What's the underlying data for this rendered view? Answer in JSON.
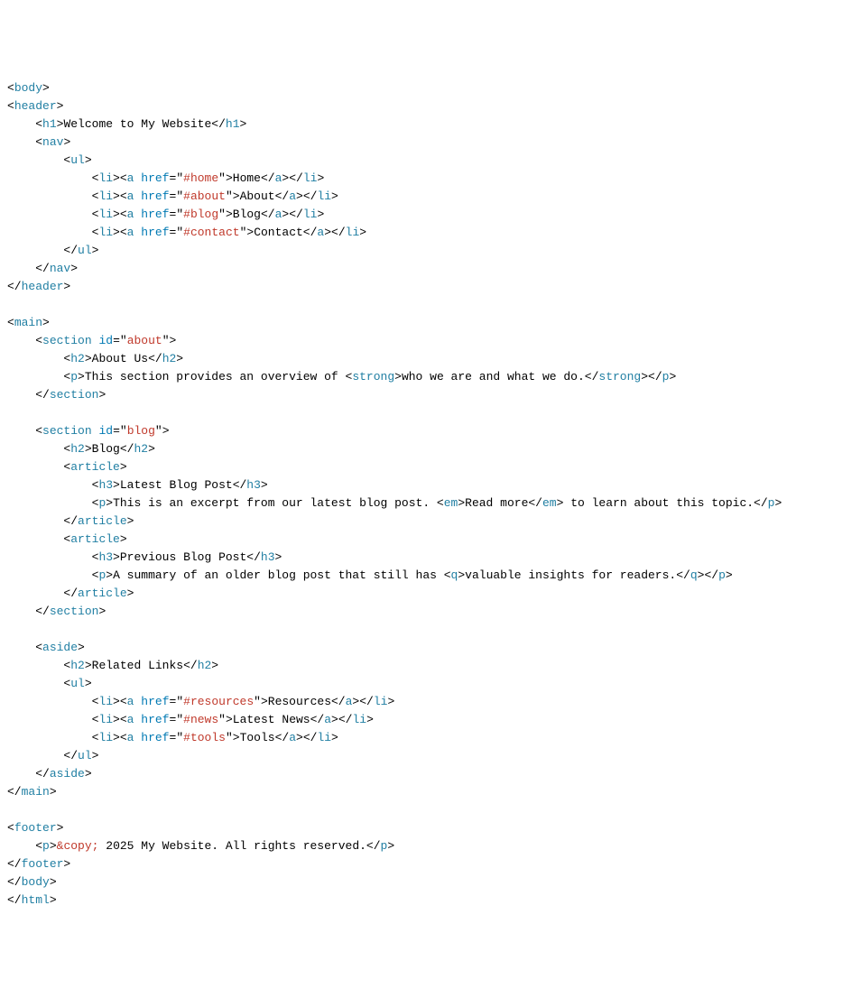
{
  "lines": [
    [
      [
        "pun",
        "<"
      ],
      [
        "tag",
        "body"
      ],
      [
        "pun",
        ">"
      ]
    ],
    [
      [
        "pun",
        "<"
      ],
      [
        "tag",
        "header"
      ],
      [
        "pun",
        ">"
      ]
    ],
    [
      [
        "txt",
        "    "
      ],
      [
        "pun",
        "<"
      ],
      [
        "tag",
        "h1"
      ],
      [
        "pun",
        ">"
      ],
      [
        "txt",
        "Welcome to My Website"
      ],
      [
        "pun",
        "</"
      ],
      [
        "tag",
        "h1"
      ],
      [
        "pun",
        ">"
      ]
    ],
    [
      [
        "txt",
        "    "
      ],
      [
        "pun",
        "<"
      ],
      [
        "tag",
        "nav"
      ],
      [
        "pun",
        ">"
      ]
    ],
    [
      [
        "txt",
        "        "
      ],
      [
        "pun",
        "<"
      ],
      [
        "tag",
        "ul"
      ],
      [
        "pun",
        ">"
      ]
    ],
    [
      [
        "txt",
        "            "
      ],
      [
        "pun",
        "<"
      ],
      [
        "tag",
        "li"
      ],
      [
        "pun",
        ">"
      ],
      [
        "pun",
        "<"
      ],
      [
        "tag",
        "a"
      ],
      [
        "txt",
        " "
      ],
      [
        "attr",
        "href"
      ],
      [
        "pun",
        "="
      ],
      [
        "pun",
        "\""
      ],
      [
        "val",
        "#home"
      ],
      [
        "pun",
        "\""
      ],
      [
        "pun",
        ">"
      ],
      [
        "txt",
        "Home"
      ],
      [
        "pun",
        "</"
      ],
      [
        "tag",
        "a"
      ],
      [
        "pun",
        ">"
      ],
      [
        "pun",
        "</"
      ],
      [
        "tag",
        "li"
      ],
      [
        "pun",
        ">"
      ]
    ],
    [
      [
        "txt",
        "            "
      ],
      [
        "pun",
        "<"
      ],
      [
        "tag",
        "li"
      ],
      [
        "pun",
        ">"
      ],
      [
        "pun",
        "<"
      ],
      [
        "tag",
        "a"
      ],
      [
        "txt",
        " "
      ],
      [
        "attr",
        "href"
      ],
      [
        "pun",
        "="
      ],
      [
        "pun",
        "\""
      ],
      [
        "val",
        "#about"
      ],
      [
        "pun",
        "\""
      ],
      [
        "pun",
        ">"
      ],
      [
        "txt",
        "About"
      ],
      [
        "pun",
        "</"
      ],
      [
        "tag",
        "a"
      ],
      [
        "pun",
        ">"
      ],
      [
        "pun",
        "</"
      ],
      [
        "tag",
        "li"
      ],
      [
        "pun",
        ">"
      ]
    ],
    [
      [
        "txt",
        "            "
      ],
      [
        "pun",
        "<"
      ],
      [
        "tag",
        "li"
      ],
      [
        "pun",
        ">"
      ],
      [
        "pun",
        "<"
      ],
      [
        "tag",
        "a"
      ],
      [
        "txt",
        " "
      ],
      [
        "attr",
        "href"
      ],
      [
        "pun",
        "="
      ],
      [
        "pun",
        "\""
      ],
      [
        "val",
        "#blog"
      ],
      [
        "pun",
        "\""
      ],
      [
        "pun",
        ">"
      ],
      [
        "txt",
        "Blog"
      ],
      [
        "pun",
        "</"
      ],
      [
        "tag",
        "a"
      ],
      [
        "pun",
        ">"
      ],
      [
        "pun",
        "</"
      ],
      [
        "tag",
        "li"
      ],
      [
        "pun",
        ">"
      ]
    ],
    [
      [
        "txt",
        "            "
      ],
      [
        "pun",
        "<"
      ],
      [
        "tag",
        "li"
      ],
      [
        "pun",
        ">"
      ],
      [
        "pun",
        "<"
      ],
      [
        "tag",
        "a"
      ],
      [
        "txt",
        " "
      ],
      [
        "attr",
        "href"
      ],
      [
        "pun",
        "="
      ],
      [
        "pun",
        "\""
      ],
      [
        "val",
        "#contact"
      ],
      [
        "pun",
        "\""
      ],
      [
        "pun",
        ">"
      ],
      [
        "txt",
        "Contact"
      ],
      [
        "pun",
        "</"
      ],
      [
        "tag",
        "a"
      ],
      [
        "pun",
        ">"
      ],
      [
        "pun",
        "</"
      ],
      [
        "tag",
        "li"
      ],
      [
        "pun",
        ">"
      ]
    ],
    [
      [
        "txt",
        "        "
      ],
      [
        "pun",
        "</"
      ],
      [
        "tag",
        "ul"
      ],
      [
        "pun",
        ">"
      ]
    ],
    [
      [
        "txt",
        "    "
      ],
      [
        "pun",
        "</"
      ],
      [
        "tag",
        "nav"
      ],
      [
        "pun",
        ">"
      ]
    ],
    [
      [
        "pun",
        "</"
      ],
      [
        "tag",
        "header"
      ],
      [
        "pun",
        ">"
      ]
    ],
    [],
    [
      [
        "pun",
        "<"
      ],
      [
        "tag",
        "main"
      ],
      [
        "pun",
        ">"
      ]
    ],
    [
      [
        "txt",
        "    "
      ],
      [
        "pun",
        "<"
      ],
      [
        "tag",
        "section"
      ],
      [
        "txt",
        " "
      ],
      [
        "attr",
        "id"
      ],
      [
        "pun",
        "="
      ],
      [
        "pun",
        "\""
      ],
      [
        "val",
        "about"
      ],
      [
        "pun",
        "\""
      ],
      [
        "pun",
        ">"
      ]
    ],
    [
      [
        "txt",
        "        "
      ],
      [
        "pun",
        "<"
      ],
      [
        "tag",
        "h2"
      ],
      [
        "pun",
        ">"
      ],
      [
        "txt",
        "About Us"
      ],
      [
        "pun",
        "</"
      ],
      [
        "tag",
        "h2"
      ],
      [
        "pun",
        ">"
      ]
    ],
    [
      [
        "txt",
        "        "
      ],
      [
        "pun",
        "<"
      ],
      [
        "tag",
        "p"
      ],
      [
        "pun",
        ">"
      ],
      [
        "txt",
        "This section provides an overview of "
      ],
      [
        "pun",
        "<"
      ],
      [
        "tag",
        "strong"
      ],
      [
        "pun",
        ">"
      ],
      [
        "txt",
        "who we are and what we do."
      ],
      [
        "pun",
        "</"
      ],
      [
        "tag",
        "strong"
      ],
      [
        "pun",
        ">"
      ],
      [
        "pun",
        "</"
      ],
      [
        "tag",
        "p"
      ],
      [
        "pun",
        ">"
      ]
    ],
    [
      [
        "txt",
        "    "
      ],
      [
        "pun",
        "</"
      ],
      [
        "tag",
        "section"
      ],
      [
        "pun",
        ">"
      ]
    ],
    [],
    [
      [
        "txt",
        "    "
      ],
      [
        "pun",
        "<"
      ],
      [
        "tag",
        "section"
      ],
      [
        "txt",
        " "
      ],
      [
        "attr",
        "id"
      ],
      [
        "pun",
        "="
      ],
      [
        "pun",
        "\""
      ],
      [
        "val",
        "blog"
      ],
      [
        "pun",
        "\""
      ],
      [
        "pun",
        ">"
      ]
    ],
    [
      [
        "txt",
        "        "
      ],
      [
        "pun",
        "<"
      ],
      [
        "tag",
        "h2"
      ],
      [
        "pun",
        ">"
      ],
      [
        "txt",
        "Blog"
      ],
      [
        "pun",
        "</"
      ],
      [
        "tag",
        "h2"
      ],
      [
        "pun",
        ">"
      ]
    ],
    [
      [
        "txt",
        "        "
      ],
      [
        "pun",
        "<"
      ],
      [
        "tag",
        "article"
      ],
      [
        "pun",
        ">"
      ]
    ],
    [
      [
        "txt",
        "            "
      ],
      [
        "pun",
        "<"
      ],
      [
        "tag",
        "h3"
      ],
      [
        "pun",
        ">"
      ],
      [
        "txt",
        "Latest Blog Post"
      ],
      [
        "pun",
        "</"
      ],
      [
        "tag",
        "h3"
      ],
      [
        "pun",
        ">"
      ]
    ],
    [
      [
        "txt",
        "            "
      ],
      [
        "pun",
        "<"
      ],
      [
        "tag",
        "p"
      ],
      [
        "pun",
        ">"
      ],
      [
        "txt",
        "This is an excerpt from our latest blog post. "
      ],
      [
        "pun",
        "<"
      ],
      [
        "tag",
        "em"
      ],
      [
        "pun",
        ">"
      ],
      [
        "txt",
        "Read more"
      ],
      [
        "pun",
        "</"
      ],
      [
        "tag",
        "em"
      ],
      [
        "pun",
        ">"
      ],
      [
        "txt",
        " to learn about this topic."
      ],
      [
        "pun",
        "</"
      ],
      [
        "tag",
        "p"
      ],
      [
        "pun",
        ">"
      ]
    ],
    [
      [
        "txt",
        "        "
      ],
      [
        "pun",
        "</"
      ],
      [
        "tag",
        "article"
      ],
      [
        "pun",
        ">"
      ]
    ],
    [
      [
        "txt",
        "        "
      ],
      [
        "pun",
        "<"
      ],
      [
        "tag",
        "article"
      ],
      [
        "pun",
        ">"
      ]
    ],
    [
      [
        "txt",
        "            "
      ],
      [
        "pun",
        "<"
      ],
      [
        "tag",
        "h3"
      ],
      [
        "pun",
        ">"
      ],
      [
        "txt",
        "Previous Blog Post"
      ],
      [
        "pun",
        "</"
      ],
      [
        "tag",
        "h3"
      ],
      [
        "pun",
        ">"
      ]
    ],
    [
      [
        "txt",
        "            "
      ],
      [
        "pun",
        "<"
      ],
      [
        "tag",
        "p"
      ],
      [
        "pun",
        ">"
      ],
      [
        "txt",
        "A summary of an older blog post that still has "
      ],
      [
        "pun",
        "<"
      ],
      [
        "tag",
        "q"
      ],
      [
        "pun",
        ">"
      ],
      [
        "txt",
        "valuable insights for readers."
      ],
      [
        "pun",
        "</"
      ],
      [
        "tag",
        "q"
      ],
      [
        "pun",
        ">"
      ],
      [
        "pun",
        "</"
      ],
      [
        "tag",
        "p"
      ],
      [
        "pun",
        ">"
      ]
    ],
    [
      [
        "txt",
        "        "
      ],
      [
        "pun",
        "</"
      ],
      [
        "tag",
        "article"
      ],
      [
        "pun",
        ">"
      ]
    ],
    [
      [
        "txt",
        "    "
      ],
      [
        "pun",
        "</"
      ],
      [
        "tag",
        "section"
      ],
      [
        "pun",
        ">"
      ]
    ],
    [],
    [
      [
        "txt",
        "    "
      ],
      [
        "pun",
        "<"
      ],
      [
        "tag",
        "aside"
      ],
      [
        "pun",
        ">"
      ]
    ],
    [
      [
        "txt",
        "        "
      ],
      [
        "pun",
        "<"
      ],
      [
        "tag",
        "h2"
      ],
      [
        "pun",
        ">"
      ],
      [
        "txt",
        "Related Links"
      ],
      [
        "pun",
        "</"
      ],
      [
        "tag",
        "h2"
      ],
      [
        "pun",
        ">"
      ]
    ],
    [
      [
        "txt",
        "        "
      ],
      [
        "pun",
        "<"
      ],
      [
        "tag",
        "ul"
      ],
      [
        "pun",
        ">"
      ]
    ],
    [
      [
        "txt",
        "            "
      ],
      [
        "pun",
        "<"
      ],
      [
        "tag",
        "li"
      ],
      [
        "pun",
        ">"
      ],
      [
        "pun",
        "<"
      ],
      [
        "tag",
        "a"
      ],
      [
        "txt",
        " "
      ],
      [
        "attr",
        "href"
      ],
      [
        "pun",
        "="
      ],
      [
        "pun",
        "\""
      ],
      [
        "val",
        "#resources"
      ],
      [
        "pun",
        "\""
      ],
      [
        "pun",
        ">"
      ],
      [
        "txt",
        "Resources"
      ],
      [
        "pun",
        "</"
      ],
      [
        "tag",
        "a"
      ],
      [
        "pun",
        ">"
      ],
      [
        "pun",
        "</"
      ],
      [
        "tag",
        "li"
      ],
      [
        "pun",
        ">"
      ]
    ],
    [
      [
        "txt",
        "            "
      ],
      [
        "pun",
        "<"
      ],
      [
        "tag",
        "li"
      ],
      [
        "pun",
        ">"
      ],
      [
        "pun",
        "<"
      ],
      [
        "tag",
        "a"
      ],
      [
        "txt",
        " "
      ],
      [
        "attr",
        "href"
      ],
      [
        "pun",
        "="
      ],
      [
        "pun",
        "\""
      ],
      [
        "val",
        "#news"
      ],
      [
        "pun",
        "\""
      ],
      [
        "pun",
        ">"
      ],
      [
        "txt",
        "Latest News"
      ],
      [
        "pun",
        "</"
      ],
      [
        "tag",
        "a"
      ],
      [
        "pun",
        ">"
      ],
      [
        "pun",
        "</"
      ],
      [
        "tag",
        "li"
      ],
      [
        "pun",
        ">"
      ]
    ],
    [
      [
        "txt",
        "            "
      ],
      [
        "pun",
        "<"
      ],
      [
        "tag",
        "li"
      ],
      [
        "pun",
        ">"
      ],
      [
        "pun",
        "<"
      ],
      [
        "tag",
        "a"
      ],
      [
        "txt",
        " "
      ],
      [
        "attr",
        "href"
      ],
      [
        "pun",
        "="
      ],
      [
        "pun",
        "\""
      ],
      [
        "val",
        "#tools"
      ],
      [
        "pun",
        "\""
      ],
      [
        "pun",
        ">"
      ],
      [
        "txt",
        "Tools"
      ],
      [
        "pun",
        "</"
      ],
      [
        "tag",
        "a"
      ],
      [
        "pun",
        ">"
      ],
      [
        "pun",
        "</"
      ],
      [
        "tag",
        "li"
      ],
      [
        "pun",
        ">"
      ]
    ],
    [
      [
        "txt",
        "        "
      ],
      [
        "pun",
        "</"
      ],
      [
        "tag",
        "ul"
      ],
      [
        "pun",
        ">"
      ]
    ],
    [
      [
        "txt",
        "    "
      ],
      [
        "pun",
        "</"
      ],
      [
        "tag",
        "aside"
      ],
      [
        "pun",
        ">"
      ]
    ],
    [
      [
        "pun",
        "</"
      ],
      [
        "tag",
        "main"
      ],
      [
        "pun",
        ">"
      ]
    ],
    [],
    [
      [
        "pun",
        "<"
      ],
      [
        "tag",
        "footer"
      ],
      [
        "pun",
        ">"
      ]
    ],
    [
      [
        "txt",
        "    "
      ],
      [
        "pun",
        "<"
      ],
      [
        "tag",
        "p"
      ],
      [
        "pun",
        ">"
      ],
      [
        "val",
        "&copy;"
      ],
      [
        "txt",
        " 2025 My Website. All rights reserved."
      ],
      [
        "pun",
        "</"
      ],
      [
        "tag",
        "p"
      ],
      [
        "pun",
        ">"
      ]
    ],
    [
      [
        "pun",
        "</"
      ],
      [
        "tag",
        "footer"
      ],
      [
        "pun",
        ">"
      ]
    ],
    [
      [
        "pun",
        "</"
      ],
      [
        "tag",
        "body"
      ],
      [
        "pun",
        ">"
      ]
    ],
    [
      [
        "pun",
        "</"
      ],
      [
        "tag",
        "html"
      ],
      [
        "pun",
        ">"
      ]
    ]
  ]
}
